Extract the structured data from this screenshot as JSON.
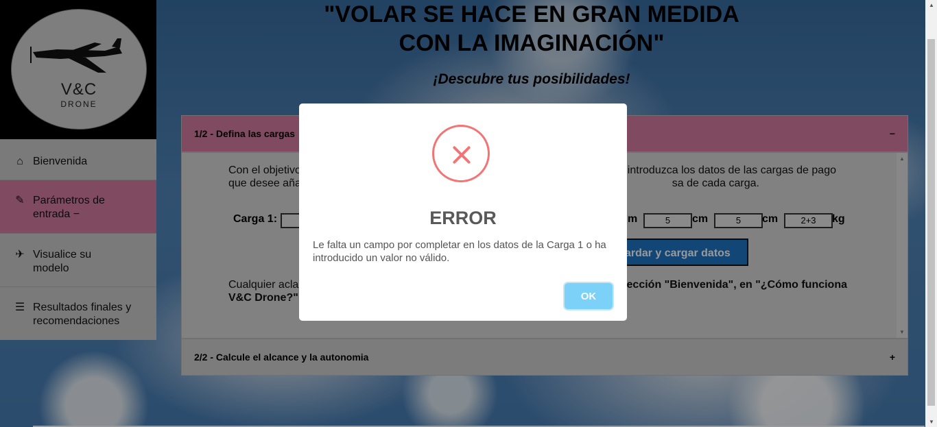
{
  "logo": {
    "brand": "V&C",
    "sub": "DRONE"
  },
  "sidebar": {
    "items": [
      {
        "label": "Bienvenida",
        "icon": "home-icon"
      },
      {
        "label": "Parámetros de entrada −",
        "icon": "edit-icon",
        "active": true
      },
      {
        "label": "Visualice su modelo",
        "icon": "plane-icon"
      },
      {
        "label": "Resultados finales y recomendaciones",
        "icon": "checklist-icon"
      }
    ]
  },
  "header": {
    "quote_line1": "\"VOLAR SE HACE EN GRAN MEDIDA",
    "quote_line2": "CON LA IMAGINACIÓN\"",
    "subtitle": "¡Descubre tus posibilidades!"
  },
  "accordion": {
    "panel1": {
      "title": "1/2 - Defina las cargas",
      "toggle": "−",
      "intro_left_line1": "Con el objetivo",
      "intro_left_line2": "que desee aña",
      "intro_right_line1": "e introduzca los datos de las cargas de pago",
      "intro_right_line2": "sa de cada carga.",
      "carga_label": "Carga 1:",
      "inputs": {
        "dim2": "5",
        "dim3": "5",
        "mass": "2+3"
      },
      "units": {
        "u1": "m",
        "u2": "cm",
        "u3": "cm",
        "u4": "kg"
      },
      "save_button": "uardar y cargar datos",
      "help_left_line1": "Cualquier acla",
      "help_left_line2": "V&C Drone?\".",
      "help_right_line1": "ección \"Bienvenida\", en \"¿Cómo funciona"
    },
    "panel2": {
      "title": "2/2 - Calcule el alcance y la autonomia",
      "toggle": "+"
    }
  },
  "modal": {
    "title": "ERROR",
    "message": "Le falta un campo por completar en los datos de la Carga 1 o ha introducido un valor no válido.",
    "ok_label": "OK",
    "icon": "error-icon",
    "accent": "#f27474",
    "ok_color": "#7cd1f9"
  },
  "colors": {
    "active_nav": "#d57ea2",
    "save_button": "#1f75c6"
  }
}
